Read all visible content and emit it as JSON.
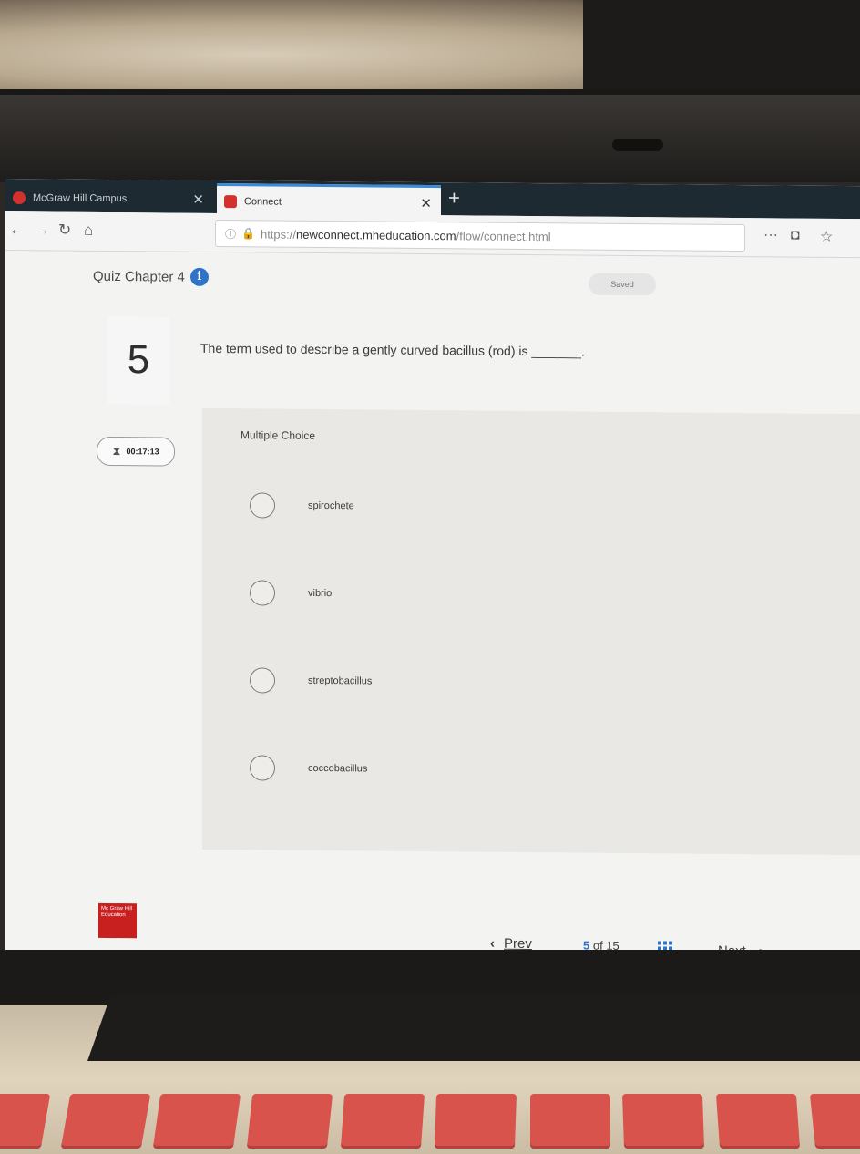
{
  "tabs": [
    {
      "label": "McGraw Hill Campus",
      "favicon_color": "#d2322d",
      "active": false
    },
    {
      "label": "Connect",
      "favicon_color": "#d2322d",
      "active": true
    }
  ],
  "browser": {
    "url_prefix": "https://",
    "url_domain": "newconnect.mheducation.com",
    "url_path": "/flow/connect.html",
    "menu_dots": "···"
  },
  "quiz": {
    "title": "Quiz Chapter 4",
    "saved_label": "Saved",
    "question_number": "5",
    "question_text": "The term used to describe a gently curved bacillus (rod) is _______.",
    "timer": "00:17:13",
    "question_type": "Multiple Choice",
    "options": [
      "spirochete",
      "vibrio",
      "streptobacillus",
      "coccobacillus"
    ]
  },
  "footer": {
    "logo_text": "Mc Graw Hill Education",
    "prev_label": "Prev",
    "current_page": "5",
    "of_label": "of 15",
    "next_label": "Next"
  },
  "colors": {
    "accent": "#2f73c8",
    "brand": "#c8201e"
  }
}
